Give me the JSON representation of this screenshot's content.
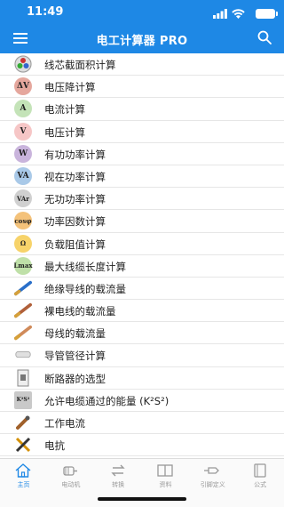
{
  "status": {
    "time": "11:49"
  },
  "header": {
    "title": "电工计算器 PRO"
  },
  "colors": {
    "accent": "#1E88E5",
    "tab_inactive": "#999999"
  },
  "menu_items": [
    {
      "label": "线芯截面积计算",
      "icon": "wire-cross-section-icon",
      "icon_text": ""
    },
    {
      "label": "电压降计算",
      "icon": "voltage-drop-icon",
      "icon_text": "ΔV"
    },
    {
      "label": "电流计算",
      "icon": "ampere-icon",
      "icon_text": "A"
    },
    {
      "label": "电压计算",
      "icon": "volt-icon",
      "icon_text": "V"
    },
    {
      "label": "有功功率计算",
      "icon": "watt-icon",
      "icon_text": "W"
    },
    {
      "label": "视在功率计算",
      "icon": "volt-ampere-icon",
      "icon_text": "VA"
    },
    {
      "label": "无功功率计算",
      "icon": "var-icon",
      "icon_text": "VAr"
    },
    {
      "label": "功率因数计算",
      "icon": "cos-phi-icon",
      "icon_text": "cosφ"
    },
    {
      "label": "负载阻值计算",
      "icon": "ohm-icon",
      "icon_text": "Ω"
    },
    {
      "label": "最大线缆长度计算",
      "icon": "max-length-icon",
      "icon_text": "Lmax"
    },
    {
      "label": "绝缘导线的载流量",
      "icon": "insulated-wire-icon",
      "icon_text": ""
    },
    {
      "label": "裸电线的载流量",
      "icon": "bare-wire-icon",
      "icon_text": ""
    },
    {
      "label": "母线的载流量",
      "icon": "busbar-icon",
      "icon_text": ""
    },
    {
      "label": "导管管径计算",
      "icon": "conduit-icon",
      "icon_text": ""
    },
    {
      "label": "断路器的选型",
      "icon": "breaker-icon",
      "icon_text": ""
    },
    {
      "label": "允许电缆通过的能量 (K²S²)",
      "icon": "k2s2-icon",
      "icon_text": "K²S²"
    },
    {
      "label": "工作电流",
      "icon": "working-current-icon",
      "icon_text": ""
    },
    {
      "label": "电抗",
      "icon": "reactance-icon",
      "icon_text": ""
    }
  ],
  "tabs": [
    {
      "label": "主页",
      "icon": "home-icon",
      "active": true
    },
    {
      "label": "电动机",
      "icon": "motor-icon",
      "active": false
    },
    {
      "label": "转换",
      "icon": "convert-icon",
      "active": false
    },
    {
      "label": "资料",
      "icon": "book-open-icon",
      "active": false
    },
    {
      "label": "引脚定义",
      "icon": "pin-icon",
      "active": false
    },
    {
      "label": "公式",
      "icon": "formula-book-icon",
      "active": false
    }
  ]
}
